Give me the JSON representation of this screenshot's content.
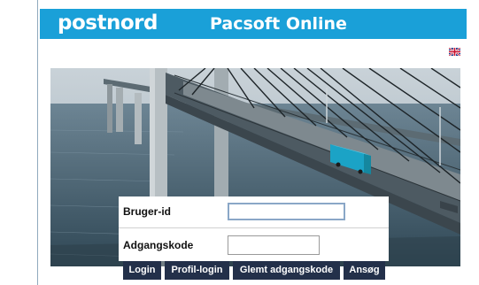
{
  "header": {
    "logo": "postnord",
    "app_title": "Pacsoft Online",
    "bg_color": "#1aa0d8"
  },
  "language": {
    "icon": "uk-flag-icon"
  },
  "hero": {
    "truck_text": ""
  },
  "login": {
    "user_label": "Bruger-id",
    "user_value": "",
    "password_label": "Adgangskode",
    "password_value": ""
  },
  "buttons": {
    "login": "Login",
    "profile_login": "Profil-login",
    "forgot_password": "Glemt adgangskode",
    "apply": "Ansøg",
    "color": "#23304a"
  }
}
